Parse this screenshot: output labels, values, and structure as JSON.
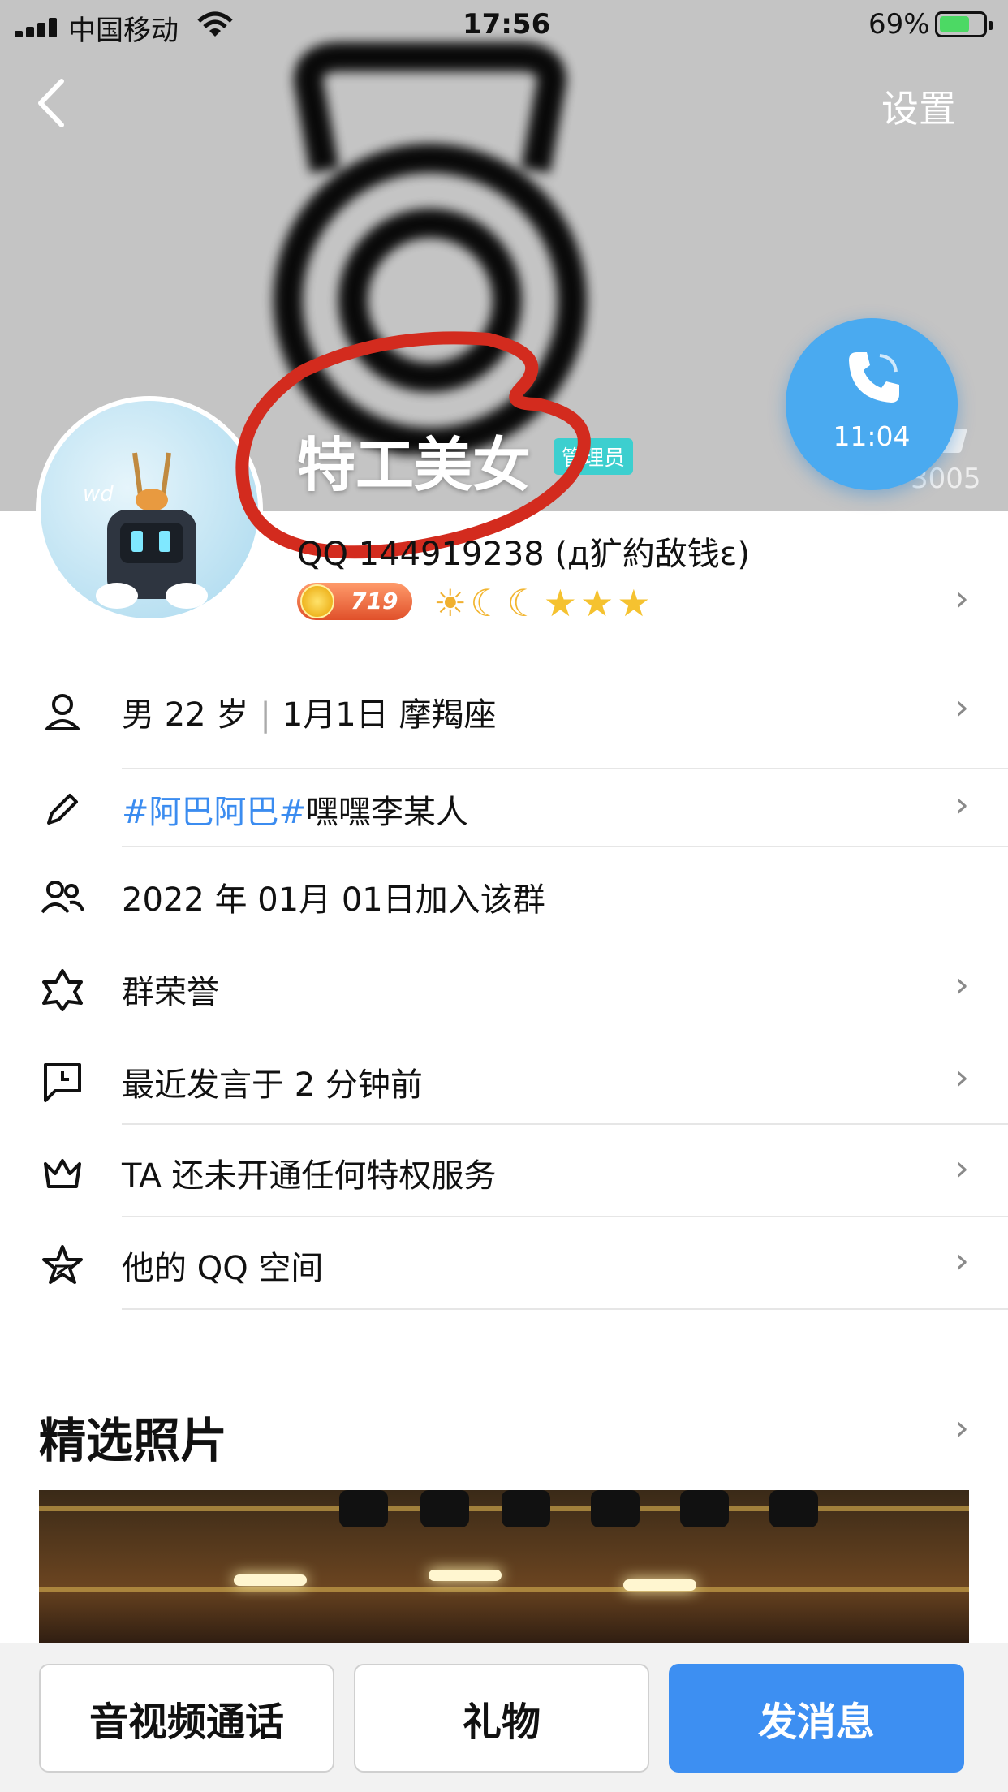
{
  "status_bar": {
    "carrier": "中国移动",
    "time": "17:56",
    "battery_percent": "69%",
    "battery_level": 0.69
  },
  "header": {
    "settings_label": "设置"
  },
  "call": {
    "duration": "11:04"
  },
  "likes": {
    "count": "3005"
  },
  "profile": {
    "avatar_tag": "wd",
    "nickname": "特工美女",
    "role_badge": "管理员",
    "qq_line": "QQ  144919238 (д犷約敌钱ε)",
    "coin_level": "719",
    "level_icons": [
      "sun",
      "moon",
      "moon",
      "star",
      "star",
      "star"
    ]
  },
  "info_rows": {
    "gender": "男",
    "age": "22 岁",
    "birthday": "1月1日",
    "zodiac": "摩羯座",
    "signature_tag": "#阿巴阿巴#",
    "signature_text": "嘿嘿李某人",
    "joined": "2022 年 01月 01日加入该群",
    "honor": "群荣誉",
    "last_speak": "最近发言于 2 分钟前",
    "privilege": "TA 还未开通任何特权服务",
    "qzone": "他的 QQ 空间"
  },
  "photos": {
    "title": "精选照片"
  },
  "actions": {
    "call_label": "音视频通话",
    "gift_label": "礼物",
    "message_label": "发消息"
  },
  "colors": {
    "accent_blue": "#3d8ff2",
    "call_fab": "#4aaaf0",
    "admin_badge": "#3ccfcf",
    "annotation_red": "#d32b1e"
  }
}
